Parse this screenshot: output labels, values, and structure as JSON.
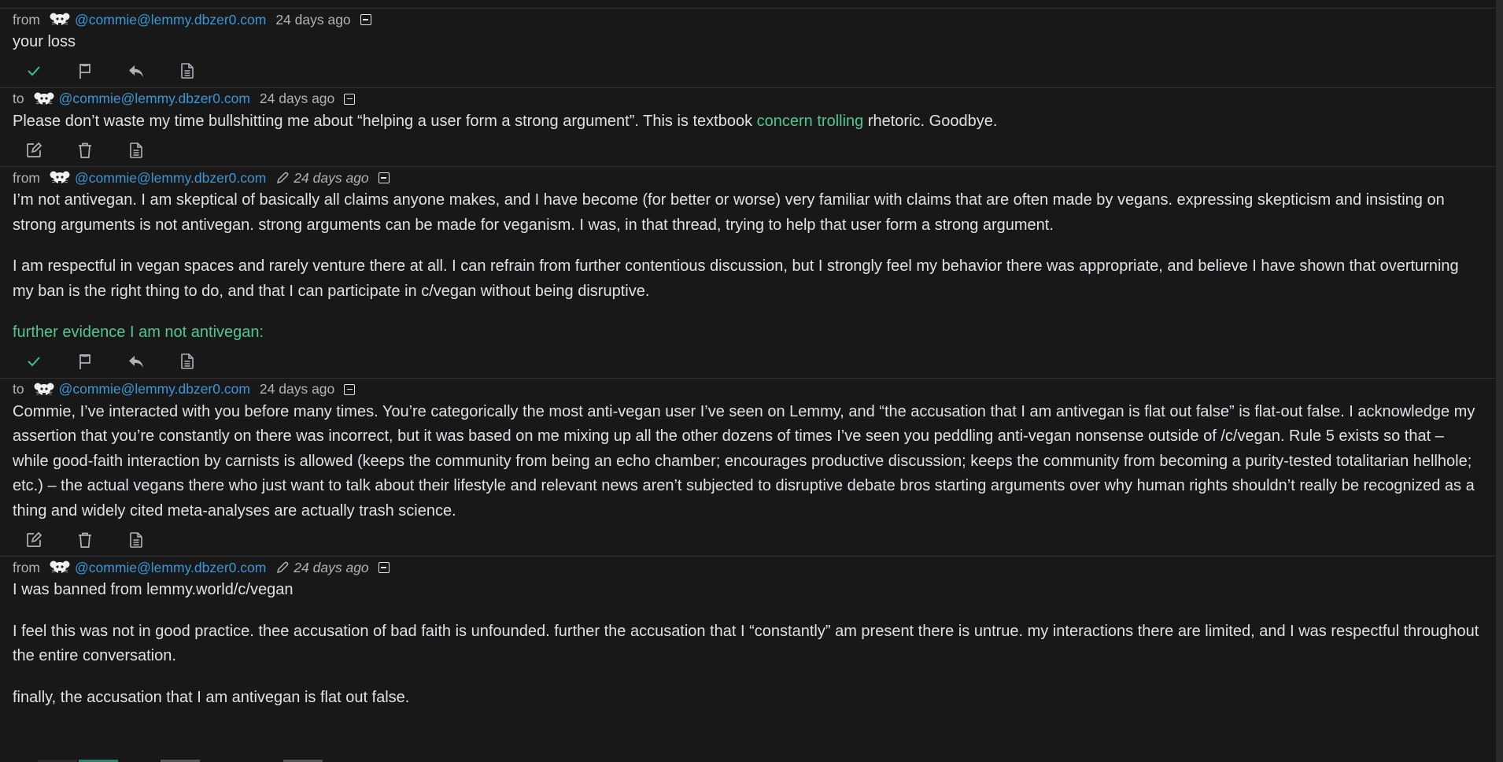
{
  "colors": {
    "background": "#181818",
    "text": "#dee2e6",
    "muted": "#aeb3b8",
    "user_link": "#3b97d8",
    "accent_green": "#4fc690",
    "divider": "#303030"
  },
  "messages": [
    {
      "direction": "from",
      "user": "@commie@lemmy.dbzer0.com",
      "time": "24 days ago",
      "edited": false,
      "paragraphs": [
        {
          "segments": [
            {
              "text": "your loss"
            }
          ]
        }
      ],
      "actions": [
        "mark-read",
        "report",
        "reply",
        "view-source"
      ]
    },
    {
      "direction": "to",
      "user": "@commie@lemmy.dbzer0.com",
      "time": "24 days ago",
      "edited": false,
      "paragraphs": [
        {
          "segments": [
            {
              "text": "Please don’t waste my time bullshitting me about “helping a user form a strong argument”. This is textbook "
            },
            {
              "text": "concern trolling",
              "link": true
            },
            {
              "text": " rhetoric. Goodbye."
            }
          ]
        }
      ],
      "actions": [
        "edit",
        "delete",
        "view-source"
      ]
    },
    {
      "direction": "from",
      "user": "@commie@lemmy.dbzer0.com",
      "time": "24 days ago",
      "edited": true,
      "paragraphs": [
        {
          "segments": [
            {
              "text": "I’m not antivegan. I am skeptical of basically all claims anyone makes, and I have become (for better or worse) very familiar with claims that are often made by vegans. expressing skepticism and insisting on strong arguments is not antivegan. strong arguments can be made for veganism. I was, in that thread, trying to help that user form a strong argument."
            }
          ]
        },
        {
          "segments": [
            {
              "text": "I am respectful in vegan spaces and rarely venture there at all. I can refrain from further contentious discussion, but I strongly feel my behavior there was appropriate, and believe I have shown that overturning my ban is the right thing to do, and that I can participate in c/vegan without being disruptive."
            }
          ]
        },
        {
          "segments": [
            {
              "text": "further evidence I am not antivegan:",
              "link": true
            }
          ]
        }
      ],
      "actions": [
        "mark-read",
        "report",
        "reply",
        "view-source"
      ]
    },
    {
      "direction": "to",
      "user": "@commie@lemmy.dbzer0.com",
      "time": "24 days ago",
      "edited": false,
      "paragraphs": [
        {
          "segments": [
            {
              "text": "Commie, I’ve interacted with you before many times. You’re categorically the most anti-vegan user I’ve seen on Lemmy, and “the accusation that I am antivegan is flat out false” is flat-out false. I acknowledge my assertion that you’re constantly on there was incorrect, but it was based on me mixing up all the other dozens of times I’ve seen you peddling anti-vegan nonsense outside of /c/vegan. Rule 5 exists so that – while good-faith interaction by carnists is allowed (keeps the community from being an echo chamber; encourages productive discussion; keeps the community from becoming a purity-tested totalitarian hellhole; etc.) – the actual vegans there who just want to talk about their lifestyle and relevant news aren’t subjected to disruptive debate bros starting arguments over why human rights shouldn’t really be recognized as a thing and widely cited meta-analyses are actually trash science."
            }
          ]
        }
      ],
      "actions": [
        "edit",
        "delete",
        "view-source"
      ]
    },
    {
      "direction": "from",
      "user": "@commie@lemmy.dbzer0.com",
      "time": "24 days ago",
      "edited": true,
      "paragraphs": [
        {
          "segments": [
            {
              "text": "I was banned from lemmy.world/c/vegan"
            }
          ]
        },
        {
          "segments": [
            {
              "text": "I feel this was not in good practice. thee accusation of bad faith is unfounded. further the accusation that I “constantly” am present there is untrue. my interactions there are limited, and I was respectful throughout the entire conversation."
            }
          ]
        },
        {
          "segments": [
            {
              "text": "finally, the accusation that I am antivegan is flat out false."
            }
          ]
        }
      ],
      "actions": []
    }
  ]
}
